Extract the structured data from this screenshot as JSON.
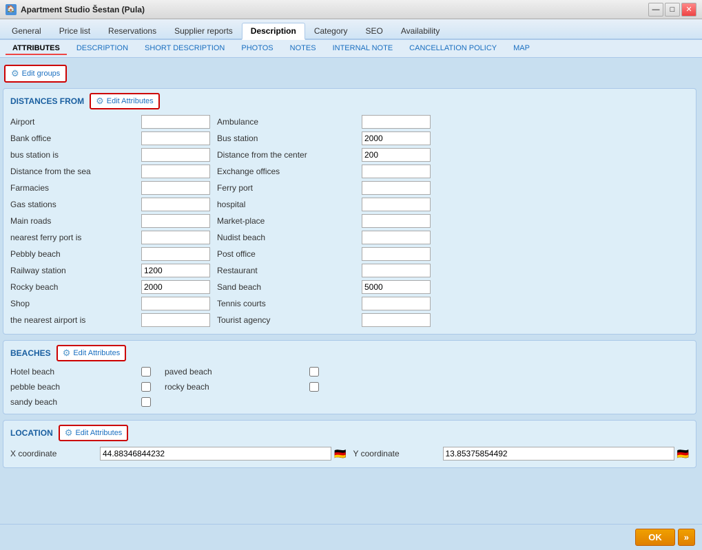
{
  "titleBar": {
    "icon": "🏠",
    "title": "Apartment Studio Šestan (Pula)",
    "buttons": [
      "—",
      "□",
      "✕"
    ]
  },
  "topTabs": [
    {
      "label": "General",
      "active": false
    },
    {
      "label": "Price list",
      "active": false
    },
    {
      "label": "Reservations",
      "active": false
    },
    {
      "label": "Supplier reports",
      "active": false
    },
    {
      "label": "Description",
      "active": true
    },
    {
      "label": "Category",
      "active": false
    },
    {
      "label": "SEO",
      "active": false
    },
    {
      "label": "Availability",
      "active": false
    }
  ],
  "subTabs": [
    {
      "label": "ATTRIBUTES",
      "active": true
    },
    {
      "label": "DESCRIPTION",
      "active": false
    },
    {
      "label": "SHORT DESCRIPTION",
      "active": false
    },
    {
      "label": "PHOTOS",
      "active": false
    },
    {
      "label": "NOTES",
      "active": false
    },
    {
      "label": "INTERNAL NOTE",
      "active": false
    },
    {
      "label": "CANCELLATION POLICY",
      "active": false
    },
    {
      "label": "MAP",
      "active": false
    }
  ],
  "editGroupsLabel": "Edit groups",
  "sections": {
    "distances": {
      "title": "DISTANCES FROM",
      "editAttrLabel": "Edit Attributes",
      "fields": [
        {
          "label": "Airport",
          "value": "",
          "col": 0
        },
        {
          "label": "Ambulance",
          "value": "",
          "col": 1
        },
        {
          "label": "Bank office",
          "value": "",
          "col": 0
        },
        {
          "label": "Bus station",
          "value": "2000",
          "col": 1
        },
        {
          "label": "bus station is",
          "value": "",
          "col": 0
        },
        {
          "label": "Distance from the center",
          "value": "200",
          "col": 1
        },
        {
          "label": "Distance from the sea",
          "value": "",
          "col": 0
        },
        {
          "label": "Exchange offices",
          "value": "",
          "col": 1
        },
        {
          "label": "Farmacies",
          "value": "",
          "col": 0
        },
        {
          "label": "Ferry port",
          "value": "",
          "col": 1
        },
        {
          "label": "Gas stations",
          "value": "",
          "col": 0
        },
        {
          "label": "hospital",
          "value": "",
          "col": 1
        },
        {
          "label": "Main roads",
          "value": "",
          "col": 0
        },
        {
          "label": "Market-place",
          "value": "",
          "col": 1
        },
        {
          "label": "nearest ferry port is",
          "value": "",
          "col": 0
        },
        {
          "label": "Nudist beach",
          "value": "",
          "col": 1
        },
        {
          "label": "Pebbly beach",
          "value": "",
          "col": 0
        },
        {
          "label": "Post office",
          "value": "",
          "col": 1
        },
        {
          "label": "Railway station",
          "value": "1200",
          "col": 0
        },
        {
          "label": "Restaurant",
          "value": "",
          "col": 1
        },
        {
          "label": "Rocky beach",
          "value": "2000",
          "col": 0
        },
        {
          "label": "Sand beach",
          "value": "5000",
          "col": 1
        },
        {
          "label": "Shop",
          "value": "",
          "col": 0
        },
        {
          "label": "Tennis courts",
          "value": "",
          "col": 1
        },
        {
          "label": "the nearest airport is",
          "value": "",
          "col": 0
        },
        {
          "label": "Tourist agency",
          "value": "",
          "col": 1
        }
      ]
    },
    "beaches": {
      "title": "BEACHES",
      "editAttrLabel": "Edit Attributes",
      "leftItems": [
        {
          "label": "Hotel beach",
          "checked": false
        },
        {
          "label": "pebble beach",
          "checked": false
        },
        {
          "label": "sandy beach",
          "checked": false
        }
      ],
      "rightItems": [
        {
          "label": "paved beach",
          "checked": false
        },
        {
          "label": "rocky beach",
          "checked": false
        }
      ]
    },
    "location": {
      "title": "LOCATION",
      "editAttrLabel": "Edit Attributes",
      "xLabel": "X coordinate",
      "xValue": "44.88346844232",
      "yLabel": "Y coordinate",
      "yValue": "13.85375854492"
    }
  },
  "bottomBar": {
    "okLabel": "OK",
    "nextLabel": "»"
  }
}
